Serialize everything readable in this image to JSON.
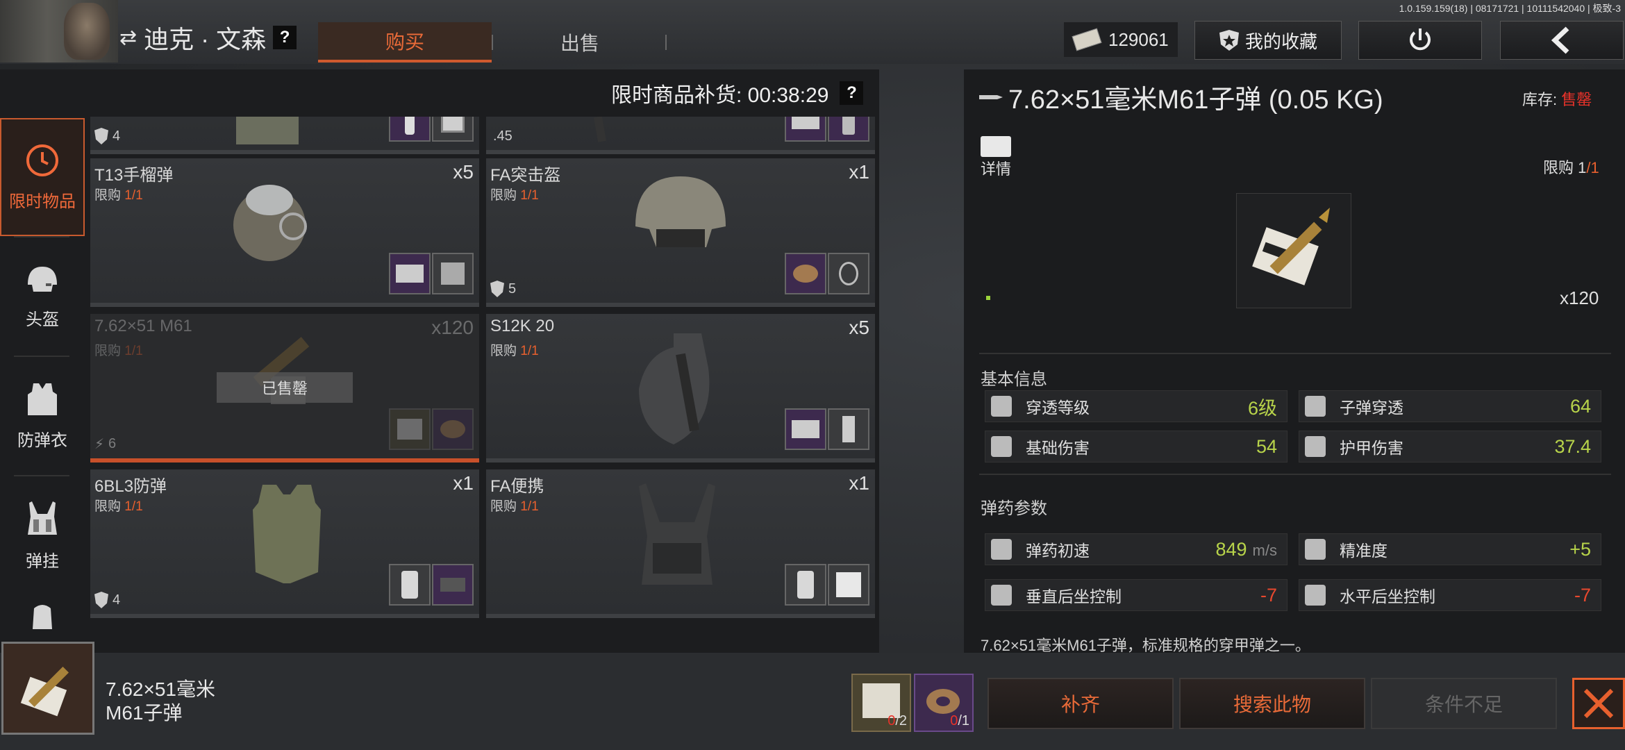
{
  "version": "1.0.159.159(18) | 08171721 | 10111542040 | 极致-3",
  "header": {
    "trader_name": "迪克 · 文森",
    "help": "?",
    "tab_buy": "购买",
    "tab_sell": "出售",
    "money": "129061",
    "favorites": "我的收藏"
  },
  "restock": {
    "label": "限时商品补货: 00:38:29",
    "help": "?"
  },
  "sidebar": {
    "items": [
      {
        "label": "限时物品",
        "icon": "clock-icon"
      },
      {
        "label": "头盔",
        "icon": "helmet-icon"
      },
      {
        "label": "防弹衣",
        "icon": "vest-icon"
      },
      {
        "label": "弹挂",
        "icon": "rig-icon"
      }
    ]
  },
  "cards": [
    {
      "name": "",
      "qty": "",
      "limit_label": "",
      "limit_val": "",
      "armor": "4",
      "caliber": ""
    },
    {
      "name": "",
      "qty": "",
      "limit_label": "",
      "limit_val": "",
      "armor": "",
      "caliber": ".45"
    },
    {
      "name": "T13手榴弹",
      "qty": "x5",
      "limit_label": "限购",
      "limit_val": "1/1",
      "armor": "",
      "caliber": ""
    },
    {
      "name": "FA突击盔",
      "qty": "x1",
      "limit_label": "限购",
      "limit_val": "1/1",
      "armor": "5",
      "caliber": ""
    },
    {
      "name": "7.62×51 M61",
      "qty": "x120",
      "limit_label": "限购",
      "limit_val": "1/1",
      "armor": "6",
      "caliber": "",
      "sold": "已售罄"
    },
    {
      "name": "S12K 20",
      "qty": "x5",
      "limit_label": "限购",
      "limit_val": "1/1",
      "armor": "",
      "caliber": ""
    },
    {
      "name": "6BL3防弹",
      "qty": "x1",
      "limit_label": "限购",
      "limit_val": "1/1",
      "armor": "4",
      "caliber": ""
    },
    {
      "name": "FA便携",
      "qty": "x1",
      "limit_label": "限购",
      "limit_val": "1/1",
      "armor": "",
      "caliber": ""
    }
  ],
  "detail": {
    "title": "7.62×51毫米M61子弹 (0.05 KG)",
    "stock_label": "库存:",
    "stock_val": "售罄",
    "details_label": "详情",
    "limit_label": "限购",
    "limit_have": "1",
    "limit_total": "/1",
    "count": "x120",
    "basic_info": "基本信息",
    "ammo_params": "弹药参数",
    "stats": [
      {
        "label": "穿透等级",
        "value": "6级"
      },
      {
        "label": "子弹穿透",
        "value": "64"
      },
      {
        "label": "基础伤害",
        "value": "54"
      },
      {
        "label": "护甲伤害",
        "value": "37.4"
      },
      {
        "label": "弹药初速",
        "value": "849",
        "unit": "m/s"
      },
      {
        "label": "精准度",
        "value": "+5"
      },
      {
        "label": "垂直后坐控制",
        "value": "-7"
      },
      {
        "label": "水平后坐控制",
        "value": "-7"
      }
    ],
    "description": "7.62×51毫米M61子弹，标准规格的穿甲弹之一。"
  },
  "bottom": {
    "item_line1": "7.62×51毫米",
    "item_line2": "M61子弹",
    "req1_have": "0",
    "req1_need": "/2",
    "req2_have": "0",
    "req2_need": "/1",
    "btn_fill": "补齐",
    "btn_search": "搜索此物",
    "btn_condition": "条件不足"
  }
}
